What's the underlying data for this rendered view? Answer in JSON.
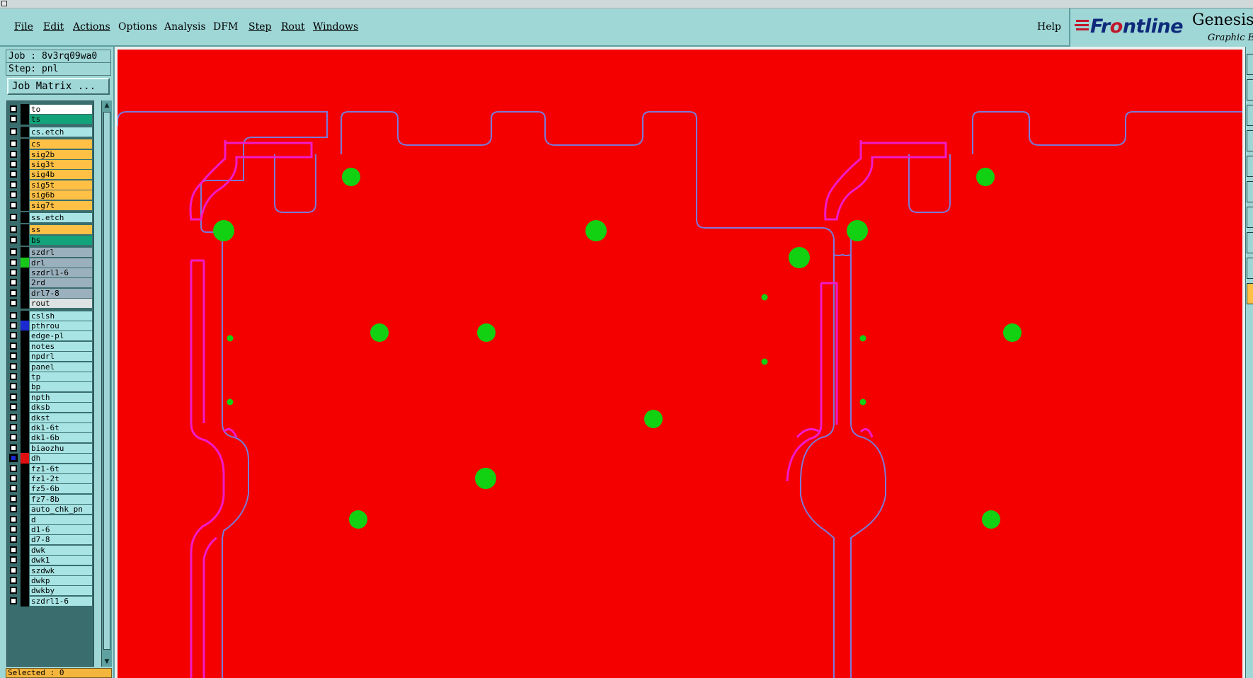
{
  "menu": [
    {
      "name": "file",
      "label": "File"
    },
    {
      "name": "edit",
      "label": "Edit"
    },
    {
      "name": "actions",
      "label": "Actions"
    },
    {
      "name": "options",
      "label": "Options"
    },
    {
      "name": "analysis",
      "label": "Analysis"
    },
    {
      "name": "dfm",
      "label": "DFM"
    },
    {
      "name": "step",
      "label": "Step"
    },
    {
      "name": "rout",
      "label": "Rout"
    },
    {
      "name": "windows",
      "label": "Windows"
    }
  ],
  "help_label": "Help",
  "logo": {
    "brand_pre": "Fr",
    "brand_dot": "o",
    "brand_post": "ntline",
    "product": "Genesis",
    "subtitle": "Graphic Ed"
  },
  "job": {
    "job_line": "Job : 8v3rq09wa0",
    "step_line": "Step: pnl",
    "matrix_button": "Job Matrix ..."
  },
  "layers": [
    {
      "name": "to",
      "color": "white",
      "swatch": "#000000"
    },
    {
      "name": "ts",
      "color": "green",
      "swatch": "#000000"
    },
    {
      "name": "cs.etch",
      "color": "cyan",
      "swatch": "#000000",
      "gap": true
    },
    {
      "name": "cs",
      "color": "orange",
      "swatch": "#000000",
      "gap": true
    },
    {
      "name": "sig2b",
      "color": "orange",
      "swatch": "#000000"
    },
    {
      "name": "sig3t",
      "color": "orange",
      "swatch": "#000000"
    },
    {
      "name": "sig4b",
      "color": "orange",
      "swatch": "#000000"
    },
    {
      "name": "sig5t",
      "color": "orange",
      "swatch": "#000000"
    },
    {
      "name": "sig6b",
      "color": "orange",
      "swatch": "#000000"
    },
    {
      "name": "sig7t",
      "color": "orange",
      "swatch": "#000000"
    },
    {
      "name": "ss.etch",
      "color": "cyan",
      "swatch": "#000000",
      "gap": true
    },
    {
      "name": "ss",
      "color": "orange",
      "swatch": "#000000",
      "gap": true
    },
    {
      "name": "bs",
      "color": "green",
      "swatch": "#000000"
    },
    {
      "name": "szdrl",
      "color": "blue",
      "swatch": "#000000",
      "gap": true
    },
    {
      "name": "drl",
      "color": "blue",
      "swatch": "#18c818"
    },
    {
      "name": "szdrl1-6",
      "color": "blue",
      "swatch": "#000000"
    },
    {
      "name": "2rd",
      "color": "blue",
      "swatch": "#000000"
    },
    {
      "name": "drl7-8",
      "color": "blue",
      "swatch": "#000000"
    },
    {
      "name": "rout",
      "color": "lgray",
      "swatch": "#000000"
    },
    {
      "name": "cslsh",
      "color": "cyan",
      "swatch": "#000000",
      "gap": true
    },
    {
      "name": "pthrou",
      "color": "cyan",
      "swatch": "#1a2ad0"
    },
    {
      "name": "edge-pl",
      "color": "cyan",
      "swatch": "#000000"
    },
    {
      "name": "notes",
      "color": "cyan",
      "swatch": "#000000"
    },
    {
      "name": "npdrl",
      "color": "cyan",
      "swatch": "#000000"
    },
    {
      "name": "panel",
      "color": "cyan",
      "swatch": "#000000"
    },
    {
      "name": "tp",
      "color": "cyan",
      "swatch": "#000000"
    },
    {
      "name": "bp",
      "color": "cyan",
      "swatch": "#000000"
    },
    {
      "name": "npth",
      "color": "cyan",
      "swatch": "#000000"
    },
    {
      "name": "dksb",
      "color": "cyan",
      "swatch": "#000000"
    },
    {
      "name": "dkst",
      "color": "cyan",
      "swatch": "#000000"
    },
    {
      "name": "dk1-6t",
      "color": "cyan",
      "swatch": "#000000"
    },
    {
      "name": "dk1-6b",
      "color": "cyan",
      "swatch": "#000000"
    },
    {
      "name": "biaozhu",
      "color": "cyan",
      "swatch": "#000000"
    },
    {
      "name": "dh",
      "color": "cyan",
      "swatch": "#e01010",
      "active": true
    },
    {
      "name": "fz1-6t",
      "color": "cyan",
      "swatch": "#000000"
    },
    {
      "name": "fz1-2t",
      "color": "cyan",
      "swatch": "#000000"
    },
    {
      "name": "fz5-6b",
      "color": "cyan",
      "swatch": "#000000"
    },
    {
      "name": "fz7-8b",
      "color": "cyan",
      "swatch": "#000000"
    },
    {
      "name": "auto_chk_pn",
      "color": "cyan",
      "swatch": "#000000"
    },
    {
      "name": "d",
      "color": "cyan",
      "swatch": "#000000"
    },
    {
      "name": "d1-6",
      "color": "cyan",
      "swatch": "#000000"
    },
    {
      "name": "d7-8",
      "color": "cyan",
      "swatch": "#000000"
    },
    {
      "name": "dwk",
      "color": "cyan",
      "swatch": "#000000"
    },
    {
      "name": "dwk1",
      "color": "cyan",
      "swatch": "#000000"
    },
    {
      "name": "szdwk",
      "color": "cyan",
      "swatch": "#000000"
    },
    {
      "name": "dwkp",
      "color": "cyan",
      "swatch": "#000000"
    },
    {
      "name": "dwkby",
      "color": "cyan",
      "swatch": "#000000"
    },
    {
      "name": "szdrl1-6",
      "color": "cyan",
      "swatch": "#000000"
    }
  ],
  "status": {
    "selected": "Selected : 0"
  },
  "colors": {
    "board_fill": "#f40000",
    "pad_green": "#12d012",
    "rout_magenta": "#f01ac8",
    "outline_blue": "#7a7ad8"
  }
}
